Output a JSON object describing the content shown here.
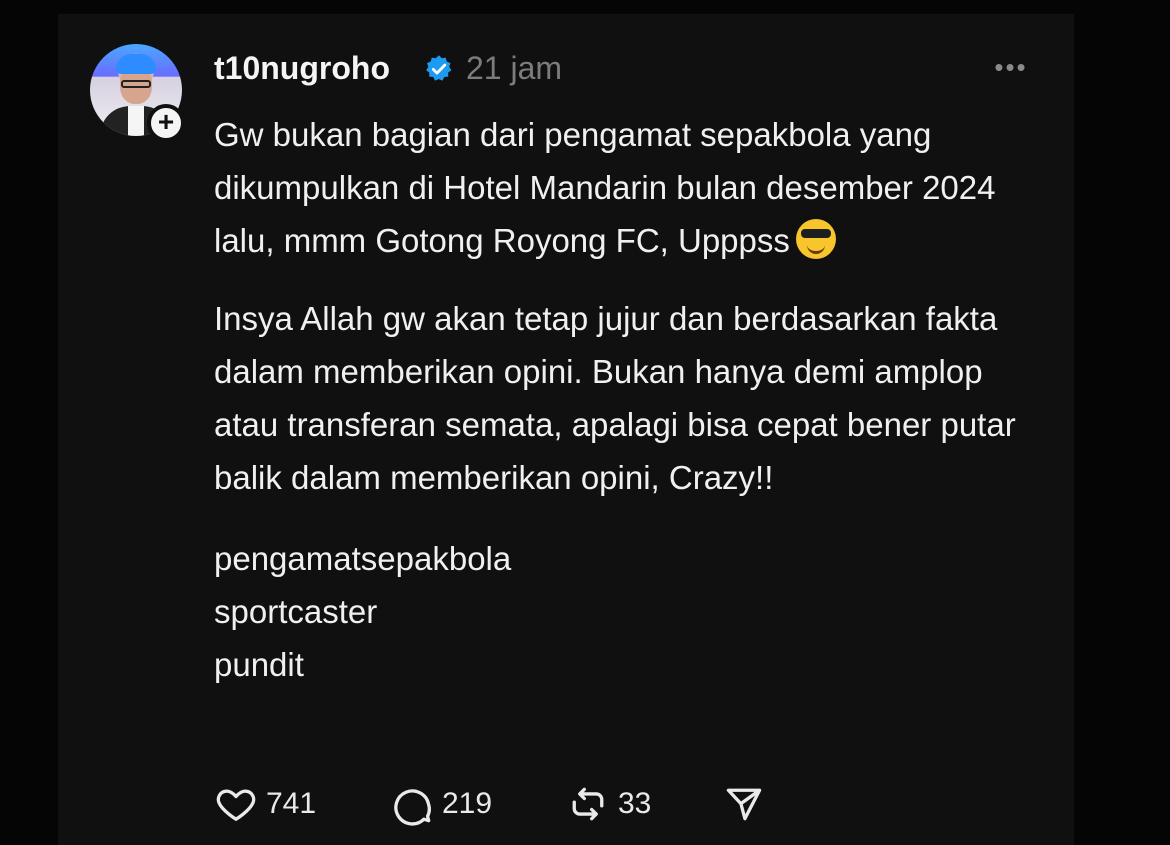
{
  "post": {
    "username": "t10nugroho",
    "time": "21 jam",
    "more_label": "•••",
    "paragraph1_text": "Gw bukan bagian dari pengamat sepakbola yang dikumpulkan di Hotel Mandarin bulan desember 2024 lalu, mmm Gotong Royong FC, Upppss",
    "paragraph2": "Insya Allah gw akan tetap jujur dan berdasarkan fakta dalam memberikan opini. Bukan hanya demi amplop atau transferan semata, apalagi bisa cepat bener putar balik dalam memberikan opini, Crazy!!",
    "tags": [
      "pengamatsepakbola",
      "sportcaster",
      "pundit"
    ]
  },
  "actions": {
    "likes": "741",
    "comments": "219",
    "reposts": "33"
  },
  "icons": {
    "verified": "verified-badge-icon",
    "follow": "plus-icon",
    "emoji": "sunglasses-emoji-icon",
    "like": "heart-icon",
    "comment": "comment-bubble-icon",
    "repost": "repost-icon",
    "share": "send-icon"
  },
  "colors": {
    "background": "#050505",
    "card": "#101010",
    "text": "#f0f0f0",
    "muted": "#7c7c7c",
    "verified": "#1d9bf0"
  }
}
